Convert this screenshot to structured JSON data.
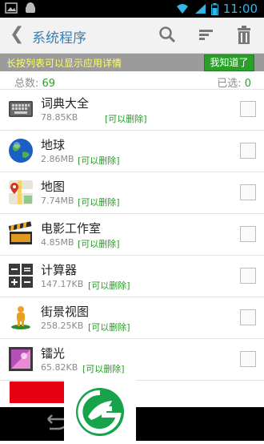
{
  "status_bar": {
    "time": "11:00"
  },
  "header": {
    "title": "系统程序",
    "icons": [
      "back-icon",
      "search-icon",
      "sort-icon",
      "trash-icon"
    ]
  },
  "tip": {
    "text": "长按列表可以显示应用详情",
    "button": "我知道了"
  },
  "summary": {
    "total_label": "总数: ",
    "total_value": "69",
    "selected_label": "已选: ",
    "selected_value": "0"
  },
  "apps": [
    {
      "name": "词典大全",
      "size": "78.85KB",
      "action": "[可以删除]",
      "icon": "keyboard-dictionary-icon"
    },
    {
      "name": "地球",
      "size": "2.86MB",
      "action": "[可以删除]",
      "icon": "earth-icon"
    },
    {
      "name": "地图",
      "size": "7.74MB",
      "action": "[可以删除]",
      "icon": "maps-icon"
    },
    {
      "name": "电影工作室",
      "size": "4.85MB",
      "action": "[可以删除]",
      "icon": "movie-clapper-icon"
    },
    {
      "name": "计算器",
      "size": "147.17KB",
      "action": "[可以删除]",
      "icon": "calculator-icon"
    },
    {
      "name": "街景视图",
      "size": "258.25KB",
      "action": "[可以删除]",
      "icon": "street-view-icon"
    },
    {
      "name": "镭光",
      "size": "65.82KB",
      "action": "[可以删除]",
      "icon": "phase-beam-icon"
    }
  ],
  "colors": {
    "accent": "#3a7fb0",
    "green": "#2aa02a",
    "red": "#e60012",
    "tip_text": "#ffff66"
  }
}
